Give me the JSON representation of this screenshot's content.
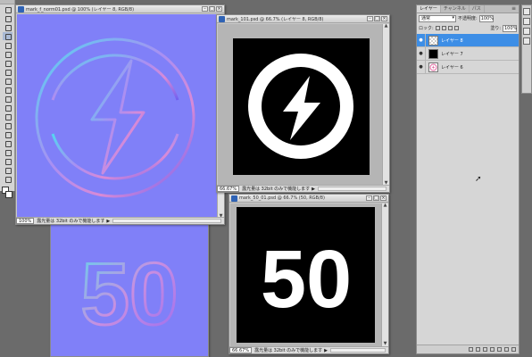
{
  "documents": [
    {
      "id": "mark_f_norm01",
      "title": "mark_f_norm01.psd @ 100% (レイヤー 8, RGB/8)",
      "zoom": "100%",
      "status": "露光量は 32bit のみで機能します",
      "art": "normal-map lightning icon"
    },
    {
      "id": "mark_101",
      "title": "mark_101.psd @ 66.7% (レイヤー 8, RGB/8)",
      "zoom": "66.67%",
      "status": "露光量は 32bit のみで機能します",
      "art": "white lightning icon on black"
    },
    {
      "id": "mark_50_01",
      "title": "mark_50_01.psd @ 66.7% (50, RGB/8)",
      "zoom": "66.67%",
      "status": "露光量は 32bit のみで機能します",
      "art_text": "50"
    },
    {
      "id": "mark_50_norm",
      "art_text": "50"
    }
  ],
  "layers_panel": {
    "tabs": [
      "レイヤー",
      "チャンネル",
      "パス"
    ],
    "blend_mode": "通常",
    "opacity_label": "不透明度:",
    "opacity_value": "100%",
    "lock_label": "ロック:",
    "fill_label": "塗り:",
    "fill_value": "100%",
    "layers": [
      {
        "name": "レイヤー 8",
        "selected": true,
        "thumb": "checker"
      },
      {
        "name": "レイヤー 7",
        "selected": false,
        "thumb": "black"
      },
      {
        "name": "レイヤー 6",
        "selected": false,
        "thumb": "pink-icon"
      }
    ]
  },
  "colors": {
    "workspace": "#6b6b6b",
    "normal_map_blue": "#8080f8",
    "selected_layer": "#3d8ee6"
  }
}
